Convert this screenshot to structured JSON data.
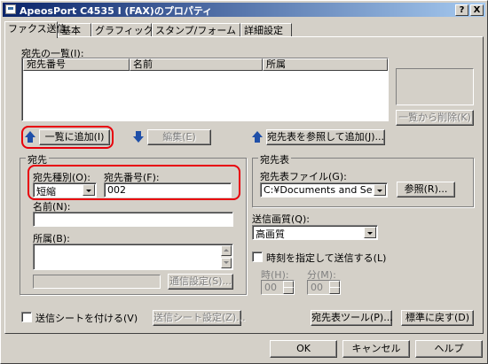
{
  "window": {
    "title": "ApeosPort C4535 I (FAX)のプロパティ",
    "help_btn": "?",
    "close_btn": "X"
  },
  "tabs": [
    "ファクス送信",
    "基本",
    "グラフィックス",
    "スタンプ/フォーム",
    "詳細設定"
  ],
  "dest_list": {
    "label": "宛先の一覧(I):",
    "columns": [
      "宛先番号",
      "名前",
      "所属"
    ],
    "delete_button": "一覧から削除(K)"
  },
  "actions": {
    "add_to_list": "一覧に追加(I)",
    "edit": "編集(E)",
    "browse_add": "宛先表を参照して追加(J)..."
  },
  "destination": {
    "group_title": "宛先",
    "type_label": "宛先種別(O):",
    "type_value": "短縮",
    "number_label": "宛先番号(F):",
    "number_value": "002",
    "name_label": "名前(N):",
    "name_value": "",
    "affiliation_label": "所属(B):",
    "affiliation_value": "",
    "comm_settings": "通信設定(S)..."
  },
  "dest_table": {
    "group_title": "宛先表",
    "file_label": "宛先表ファイル(G):",
    "file_value": "C:¥Documents and Settings¥",
    "browse_button": "参照(R)..."
  },
  "quality": {
    "label": "送信画質(Q):",
    "value": "高画質"
  },
  "timer": {
    "checkbox_label": "時刻を指定して送信する(L)",
    "hour_label": "時(H):",
    "hour_value": "00",
    "minute_label": "分(M):",
    "minute_value": "00"
  },
  "cover": {
    "checkbox_label": "送信シートを付ける(V)",
    "settings_button": "送信シート設定(Z)..."
  },
  "bottom_tools": {
    "dest_tool": "宛先表ツール(P)...",
    "reset": "標準に戻す(D)"
  },
  "footer": {
    "ok": "OK",
    "cancel": "キャンセル",
    "help": "ヘルプ"
  },
  "colors": {
    "highlight": "#e8000b",
    "titlebar_start": "#0a246a",
    "titlebar_end": "#a6caf0",
    "arrow": "#1f4fa8"
  }
}
